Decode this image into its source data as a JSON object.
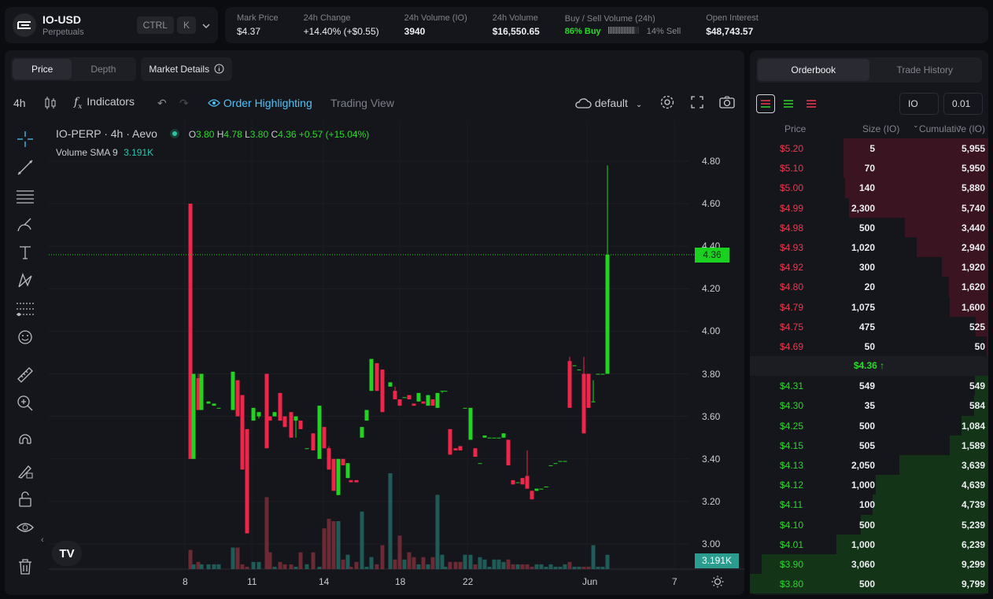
{
  "market": {
    "symbol": "IO-USD",
    "subtitle": "Perpetuals",
    "kbd1": "CTRL",
    "kbd2": "K"
  },
  "stats": {
    "mark_price_label": "Mark Price",
    "mark_price": "$4.37",
    "change_label": "24h Change",
    "change": "+14.40% (+$0.55)",
    "vol_io_label": "24h Volume (IO)",
    "vol_io": "3940",
    "vol_usd_label": "24h Volume",
    "vol_usd": "$16,550.65",
    "buysell_label": "Buy / Sell Volume (24h)",
    "buy": "86% Buy",
    "buy_fraction": 0.86,
    "sell": "14% Sell",
    "oi_label": "Open Interest",
    "oi": "$48,743.57"
  },
  "chart_tabs": {
    "price": "Price",
    "depth": "Depth",
    "details": "Market Details"
  },
  "toolbar": {
    "interval": "4h",
    "indicators": "Indicators",
    "order_highlighting": "Order Highlighting",
    "trading_view": "Trading View",
    "layout": "default"
  },
  "legend": {
    "title": "IO-PERP · 4h · Aevo",
    "o_label": "O",
    "o": "3.80",
    "h_label": "H",
    "h": "4.78",
    "l_label": "L",
    "l": "3.80",
    "c_label": "C",
    "c": "4.36",
    "chg": "+0.57 (+15.04%)",
    "vol_label": "Volume SMA 9",
    "vol": "3.191K"
  },
  "price_tag": "4.36",
  "vol_tag": "3.191K",
  "chart_data": {
    "type": "candlestick",
    "y_ticks": [
      "4.80",
      "4.60",
      "4.40",
      "4.20",
      "4.00",
      "3.80",
      "3.60",
      "3.40",
      "3.20",
      "3.00"
    ],
    "y_range": [
      3.0,
      4.8
    ],
    "x_ticks": [
      "8",
      "11",
      "14",
      "18",
      "22",
      "Jun",
      "7"
    ],
    "current_price": 4.36,
    "candles": [
      [
        4.6,
        4.6,
        3.4,
        3.4
      ],
      [
        3.4,
        3.8,
        3.4,
        3.8
      ],
      [
        3.78,
        3.8,
        3.63,
        3.63
      ],
      [
        3.63,
        3.8,
        3.63,
        3.8
      ],
      [
        3.66,
        3.67,
        3.66,
        3.67
      ],
      [
        3.65,
        3.66,
        3.65,
        3.66
      ],
      [
        3.64,
        3.64,
        3.64,
        3.64
      ],
      [
        3.63,
        3.81,
        3.63,
        3.81
      ],
      [
        3.77,
        3.77,
        3.6,
        3.6
      ],
      [
        3.7,
        3.7,
        3.35,
        3.35
      ],
      [
        3.54,
        3.54,
        3.05,
        3.05
      ],
      [
        3.58,
        3.64,
        3.58,
        3.64
      ],
      [
        3.6,
        3.62,
        3.59,
        3.62
      ],
      [
        3.8,
        3.8,
        3.45,
        3.45
      ],
      [
        3.6,
        3.6,
        3.58,
        3.58
      ],
      [
        3.6,
        3.62,
        3.6,
        3.62
      ],
      [
        3.71,
        3.71,
        3.58,
        3.58
      ],
      [
        3.6,
        3.6,
        3.55,
        3.55
      ],
      [
        3.62,
        3.62,
        3.5,
        3.5
      ],
      [
        3.58,
        3.6,
        3.5,
        3.6
      ],
      [
        3.58,
        3.58,
        3.54,
        3.54
      ],
      [
        3.45,
        3.45,
        3.45,
        3.45
      ],
      [
        3.52,
        3.52,
        3.44,
        3.44
      ],
      [
        3.4,
        3.65,
        3.4,
        3.65
      ],
      [
        3.55,
        3.55,
        3.45,
        3.45
      ],
      [
        3.45,
        3.46,
        3.35,
        3.35
      ],
      [
        3.4,
        3.4,
        3.25,
        3.25
      ],
      [
        3.23,
        3.4,
        3.23,
        3.4
      ],
      [
        3.4,
        3.4,
        3.37,
        3.37
      ],
      [
        3.31,
        3.38,
        3.31,
        3.38
      ],
      [
        3.3,
        3.3,
        3.29,
        3.29
      ],
      [
        3.3,
        3.3,
        3.29,
        3.29
      ],
      [
        3.5,
        3.55,
        3.5,
        3.55
      ],
      [
        3.58,
        3.63,
        3.58,
        3.63
      ],
      [
        3.72,
        3.87,
        3.72,
        3.87
      ],
      [
        3.85,
        3.85,
        3.72,
        3.72
      ],
      [
        3.82,
        3.82,
        3.62,
        3.62
      ],
      [
        3.74,
        3.76,
        3.74,
        3.76
      ],
      [
        3.72,
        3.74,
        3.68,
        3.68
      ],
      [
        3.68,
        3.68,
        3.65,
        3.65
      ],
      [
        3.69,
        3.69,
        3.69,
        3.69
      ],
      [
        3.7,
        3.7,
        3.68,
        3.68
      ],
      [
        3.66,
        3.66,
        3.65,
        3.65
      ],
      [
        3.67,
        3.71,
        3.67,
        3.71
      ],
      [
        3.67,
        3.67,
        3.66,
        3.66
      ],
      [
        3.65,
        3.7,
        3.65,
        3.7
      ],
      [
        3.68,
        3.68,
        3.65,
        3.65
      ],
      [
        3.64,
        3.71,
        3.64,
        3.71
      ],
      [
        3.72,
        3.72,
        3.71,
        3.72
      ],
      [
        3.72,
        3.72,
        3.72,
        3.72
      ],
      [
        3.54,
        3.54,
        3.42,
        3.42
      ],
      [
        3.45,
        3.45,
        3.44,
        3.44
      ],
      [
        3.46,
        3.46,
        3.44,
        3.44
      ],
      [
        3.64,
        3.64,
        3.64,
        3.64
      ],
      [
        3.49,
        3.64,
        3.49,
        3.64
      ],
      [
        3.45,
        3.45,
        3.41,
        3.41
      ],
      [
        3.38,
        3.38,
        3.38,
        3.38
      ],
      [
        3.5,
        3.51,
        3.5,
        3.51
      ],
      [
        3.5,
        3.5,
        3.5,
        3.5
      ],
      [
        3.5,
        3.5,
        3.5,
        3.5
      ],
      [
        3.5,
        3.5,
        3.5,
        3.5
      ],
      [
        3.5,
        3.52,
        3.5,
        3.52
      ],
      [
        3.49,
        3.49,
        3.37,
        3.37
      ],
      [
        3.3,
        3.3,
        3.28,
        3.28
      ],
      [
        3.29,
        3.29,
        3.29,
        3.29
      ],
      [
        3.31,
        3.31,
        3.28,
        3.28
      ],
      [
        3.32,
        3.44,
        3.26,
        3.26
      ],
      [
        3.25,
        3.25,
        3.21,
        3.21
      ],
      [
        3.25,
        3.26,
        3.25,
        3.26
      ],
      [
        3.26,
        3.26,
        3.26,
        3.26
      ],
      [
        3.27,
        3.27,
        3.27,
        3.27
      ],
      [
        3.37,
        3.37,
        3.37,
        3.37
      ],
      [
        3.38,
        3.38,
        3.38,
        3.38
      ],
      [
        3.39,
        3.39,
        3.39,
        3.39
      ],
      [
        3.39,
        3.39,
        3.39,
        3.39
      ],
      [
        3.86,
        3.88,
        3.64,
        3.64
      ],
      [
        3.84,
        3.84,
        3.84,
        3.84
      ],
      [
        3.82,
        3.82,
        3.82,
        3.82
      ],
      [
        3.8,
        3.88,
        3.52,
        3.52
      ],
      [
        3.8,
        3.8,
        3.64,
        3.64
      ],
      [
        3.67,
        3.77,
        3.67,
        3.67
      ],
      [
        3.8,
        3.8,
        3.8,
        3.8
      ],
      [
        3.8,
        3.8,
        3.8,
        3.8
      ],
      [
        3.8,
        4.78,
        3.8,
        4.36
      ]
    ],
    "candle_x": [
      236,
      240,
      246,
      250,
      259,
      266,
      272,
      290,
      296,
      302,
      308,
      316,
      323,
      333,
      337,
      343,
      350,
      356,
      364,
      370,
      376,
      384,
      392,
      400,
      406,
      412,
      418,
      424,
      430,
      436,
      440,
      447,
      454,
      460,
      466,
      473,
      480,
      490,
      496,
      502,
      508,
      514,
      520,
      526,
      532,
      538,
      544,
      550,
      556,
      560,
      566,
      573,
      579,
      585,
      592,
      598,
      604,
      610,
      616,
      622,
      628,
      634,
      640,
      646,
      652,
      658,
      664,
      670,
      676,
      682,
      688,
      694,
      700,
      706,
      712,
      718,
      724,
      730,
      736,
      742,
      748,
      754,
      760,
      766,
      772,
      778,
      784,
      790,
      796,
      802,
      808,
      814,
      820,
      826
    ],
    "volumes": [
      8,
      2,
      3,
      2,
      2,
      2,
      2,
      9,
      9,
      2,
      1,
      3,
      3,
      30,
      7,
      1,
      3,
      2,
      2,
      1,
      7,
      2,
      7,
      1,
      17,
      21,
      20,
      20,
      4,
      6,
      1,
      3,
      24,
      1,
      5,
      2,
      10,
      40,
      4,
      14,
      4,
      7,
      5,
      2,
      5,
      2,
      5,
      31,
      6,
      1,
      3,
      3,
      3,
      6,
      6,
      2,
      5,
      4,
      1,
      4,
      4,
      3,
      4,
      2,
      2,
      2,
      2,
      1,
      2,
      2,
      1,
      2,
      1,
      1,
      2,
      3,
      1,
      1,
      1,
      1,
      10,
      1,
      1,
      6
    ],
    "volumes_note": ""
  },
  "orderbook": {
    "tab_orderbook": "Orderbook",
    "tab_history": "Trade History",
    "unit": "IO",
    "tick": "0.01",
    "col_price": "Price",
    "col_size": "Size (IO)",
    "col_cum": "Cumulative (IO)",
    "mid": "$4.36",
    "asks": [
      {
        "price": "$5.20",
        "size": "5",
        "cum": "5,955",
        "depth": 5955
      },
      {
        "price": "$5.10",
        "size": "70",
        "cum": "5,950",
        "depth": 5950
      },
      {
        "price": "$5.00",
        "size": "140",
        "cum": "5,880",
        "depth": 5880
      },
      {
        "price": "$4.99",
        "size": "2,300",
        "cum": "5,740",
        "depth": 5740
      },
      {
        "price": "$4.98",
        "size": "500",
        "cum": "3,440",
        "depth": 3440
      },
      {
        "price": "$4.93",
        "size": "1,020",
        "cum": "2,940",
        "depth": 2940
      },
      {
        "price": "$4.92",
        "size": "300",
        "cum": "1,920",
        "depth": 1920
      },
      {
        "price": "$4.80",
        "size": "20",
        "cum": "1,620",
        "depth": 1620
      },
      {
        "price": "$4.79",
        "size": "1,075",
        "cum": "1,600",
        "depth": 1600
      },
      {
        "price": "$4.75",
        "size": "475",
        "cum": "525",
        "depth": 525
      },
      {
        "price": "$4.69",
        "size": "50",
        "cum": "50",
        "depth": 50
      }
    ],
    "bids": [
      {
        "price": "$4.31",
        "size": "549",
        "cum": "549",
        "depth": 549
      },
      {
        "price": "$4.30",
        "size": "35",
        "cum": "584",
        "depth": 584
      },
      {
        "price": "$4.25",
        "size": "500",
        "cum": "1,084",
        "depth": 1084
      },
      {
        "price": "$4.15",
        "size": "505",
        "cum": "1,589",
        "depth": 1589
      },
      {
        "price": "$4.13",
        "size": "2,050",
        "cum": "3,639",
        "depth": 3639
      },
      {
        "price": "$4.12",
        "size": "1,000",
        "cum": "4,639",
        "depth": 4639
      },
      {
        "price": "$4.11",
        "size": "100",
        "cum": "4,739",
        "depth": 4739
      },
      {
        "price": "$4.10",
        "size": "500",
        "cum": "5,239",
        "depth": 5239
      },
      {
        "price": "$4.01",
        "size": "1,000",
        "cum": "6,239",
        "depth": 6239
      },
      {
        "price": "$3.90",
        "size": "3,060",
        "cum": "9,299",
        "depth": 9299
      },
      {
        "price": "$3.80",
        "size": "500",
        "cum": "9,799",
        "depth": 9799
      }
    ]
  },
  "colors": {
    "up": "#22d322",
    "down": "#f0254a",
    "bg": "#0b0c10",
    "panel": "#15161b"
  }
}
